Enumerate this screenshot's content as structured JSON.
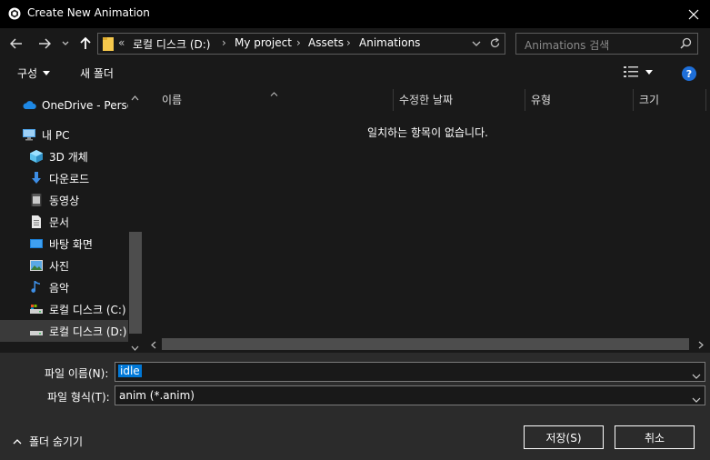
{
  "window": {
    "title": "Create New Animation"
  },
  "address": {
    "overflow": "«",
    "crumbs": [
      "로컬 디스크 (D:)",
      "My project",
      "Assets",
      "Animations"
    ]
  },
  "search": {
    "placeholder": "Animations 검색"
  },
  "toolbar": {
    "organize_label": "구성",
    "new_folder_label": "새 폴더"
  },
  "nav": {
    "items": [
      {
        "label": "OneDrive - Personal",
        "icon": "cloud-icon"
      },
      {
        "label": "내 PC",
        "icon": "pc-icon"
      },
      {
        "label": "3D 개체",
        "icon": "cube-icon"
      },
      {
        "label": "다운로드",
        "icon": "download-icon"
      },
      {
        "label": "동영상",
        "icon": "video-icon"
      },
      {
        "label": "문서",
        "icon": "document-icon"
      },
      {
        "label": "바탕 화면",
        "icon": "desktop-icon"
      },
      {
        "label": "사진",
        "icon": "picture-icon"
      },
      {
        "label": "음악",
        "icon": "music-icon"
      },
      {
        "label": "로컬 디스크 (C:)",
        "icon": "drive-icon"
      },
      {
        "label": "로컬 디스크 (D:)",
        "icon": "drive-icon"
      }
    ]
  },
  "columns": [
    "이름",
    "수정한 날짜",
    "유형",
    "크기"
  ],
  "empty_message": "일치하는 항목이 없습니다.",
  "form": {
    "filename_label": "파일 이름(N):",
    "filename_value": "idle",
    "filetype_label": "파일 형식(T):",
    "filetype_value": "anim (*.anim)"
  },
  "buttons": {
    "save": "저장(S)",
    "cancel": "취소"
  },
  "hide_folders_label": "폴더 숨기기",
  "colors": {
    "accent": "#0078d7",
    "help": "#1e6fd9",
    "folder": "#f5c84c",
    "onedrive": "#1e88e5"
  }
}
